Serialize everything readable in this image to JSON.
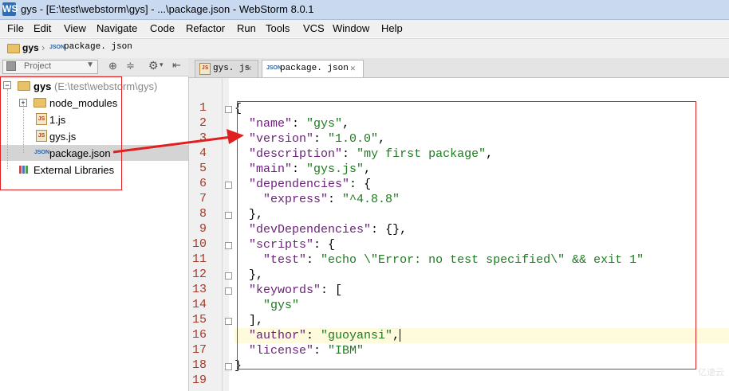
{
  "window": {
    "title": "gys - [E:\\test\\webstorm\\gys] - ...\\package.json - WebStorm 8.0.1",
    "logo": "WS"
  },
  "menu": [
    "File",
    "Edit",
    "View",
    "Navigate",
    "Code",
    "Refactor",
    "Run",
    "Tools",
    "VCS",
    "Window",
    "Help"
  ],
  "breadcrumb": {
    "folder": "gys",
    "file": "package. json",
    "file_icon": "JSON"
  },
  "project_panel": {
    "combo_label": "Project"
  },
  "tabs": [
    {
      "label": "gys. js",
      "icon": "JS",
      "active": false
    },
    {
      "label": "package. json",
      "icon": "JSON",
      "active": true
    }
  ],
  "tree": {
    "root_name": "gys",
    "root_path": "(E:\\test\\webstorm\\gys)",
    "items": [
      {
        "label": "node_modules",
        "icon": "folder-icon"
      },
      {
        "label": "1.js",
        "icon": "js-file-icon"
      },
      {
        "label": "gys.js",
        "icon": "js-file-icon"
      },
      {
        "label": "package.json",
        "icon": "json-file-icon",
        "selected": true
      }
    ],
    "external": "External Libraries"
  },
  "code": {
    "line_numbers": [
      "1",
      "2",
      "3",
      "4",
      "5",
      "6",
      "7",
      "8",
      "9",
      "10",
      "11",
      "12",
      "13",
      "14",
      "15",
      "16",
      "17",
      "18",
      "19"
    ],
    "lines": [
      {
        "indent": "",
        "key": "",
        "sep": "",
        "val": "",
        "tail": "{"
      },
      {
        "indent": "  ",
        "key": "\"name\"",
        "sep": ": ",
        "val": "\"gys\"",
        "tail": ","
      },
      {
        "indent": "  ",
        "key": "\"version\"",
        "sep": ": ",
        "val": "\"1.0.0\"",
        "tail": ","
      },
      {
        "indent": "  ",
        "key": "\"description\"",
        "sep": ": ",
        "val": "\"my first package\"",
        "tail": ","
      },
      {
        "indent": "  ",
        "key": "\"main\"",
        "sep": ": ",
        "val": "\"gys.js\"",
        "tail": ","
      },
      {
        "indent": "  ",
        "key": "\"dependencies\"",
        "sep": ": ",
        "val": "",
        "tail": "{"
      },
      {
        "indent": "    ",
        "key": "\"express\"",
        "sep": ": ",
        "val": "\"^4.8.8\"",
        "tail": ""
      },
      {
        "indent": "  ",
        "key": "",
        "sep": "",
        "val": "",
        "tail": "},"
      },
      {
        "indent": "  ",
        "key": "\"devDependencies\"",
        "sep": ": ",
        "val": "",
        "tail": "{},"
      },
      {
        "indent": "  ",
        "key": "\"scripts\"",
        "sep": ": ",
        "val": "",
        "tail": "{"
      },
      {
        "indent": "    ",
        "key": "\"test\"",
        "sep": ": ",
        "val": "\"echo \\\"Error: no test specified\\\" && exit 1\"",
        "tail": ""
      },
      {
        "indent": "  ",
        "key": "",
        "sep": "",
        "val": "",
        "tail": "},"
      },
      {
        "indent": "  ",
        "key": "\"keywords\"",
        "sep": ": ",
        "val": "",
        "tail": "["
      },
      {
        "indent": "    ",
        "key": "",
        "sep": "",
        "val": "\"gys\"",
        "tail": ""
      },
      {
        "indent": "  ",
        "key": "",
        "sep": "",
        "val": "",
        "tail": "],"
      },
      {
        "indent": "  ",
        "key": "\"author\"",
        "sep": ": ",
        "val": "\"guoyansi\"",
        "tail": ","
      },
      {
        "indent": "  ",
        "key": "\"license\"",
        "sep": ": ",
        "val": "\"IBM\"",
        "tail": ""
      },
      {
        "indent": "",
        "key": "",
        "sep": "",
        "val": "",
        "tail": "}"
      },
      {
        "indent": "",
        "key": "",
        "sep": "",
        "val": "",
        "tail": ""
      }
    ],
    "current_line": 16
  },
  "colors": {
    "annotation": "#e02020",
    "key": "#6b1f7a",
    "string": "#1f7a1f",
    "line_number": "#a43a2a"
  }
}
